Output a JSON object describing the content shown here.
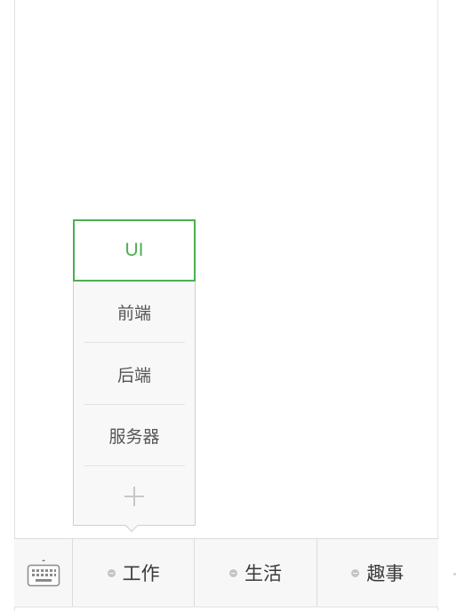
{
  "submenu": {
    "items": [
      {
        "label": "UI",
        "active": true
      },
      {
        "label": "前端",
        "active": false
      },
      {
        "label": "后端",
        "active": false
      },
      {
        "label": "服务器",
        "active": false
      }
    ],
    "add_icon": "plus-icon",
    "accent_color": "#4caf50"
  },
  "tabbar": {
    "keyboard_icon": "keyboard-icon",
    "tabs": [
      {
        "label": "工作",
        "icon": "submenu-dot-icon"
      },
      {
        "label": "生活",
        "icon": "submenu-dot-icon"
      },
      {
        "label": "趣事",
        "icon": "submenu-dot-icon"
      }
    ]
  }
}
